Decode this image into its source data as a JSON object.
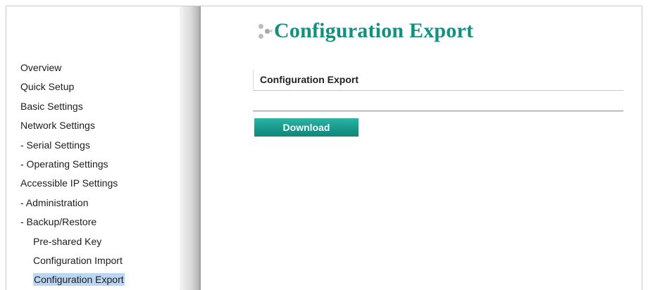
{
  "sidebar": {
    "items": [
      {
        "label": "Overview"
      },
      {
        "label": "Quick Setup"
      },
      {
        "label": "Basic Settings"
      },
      {
        "label": "Network Settings"
      },
      {
        "label": "- Serial Settings"
      },
      {
        "label": "- Operating Settings"
      },
      {
        "label": "Accessible IP Settings"
      },
      {
        "label": "- Administration"
      },
      {
        "label": "- Backup/Restore"
      },
      {
        "label": "Pre-shared Key"
      },
      {
        "label": "Configuration Import"
      },
      {
        "label": "Configuration Export"
      }
    ],
    "active_item": "Configuration Export"
  },
  "main": {
    "title": "Configuration Export",
    "title_icon": "dots-icon",
    "section_header": "Configuration Export",
    "download_label": "Download"
  },
  "colors": {
    "title": "#14907f",
    "button": "#17998b",
    "active_highlight": "#bcd6f2"
  }
}
